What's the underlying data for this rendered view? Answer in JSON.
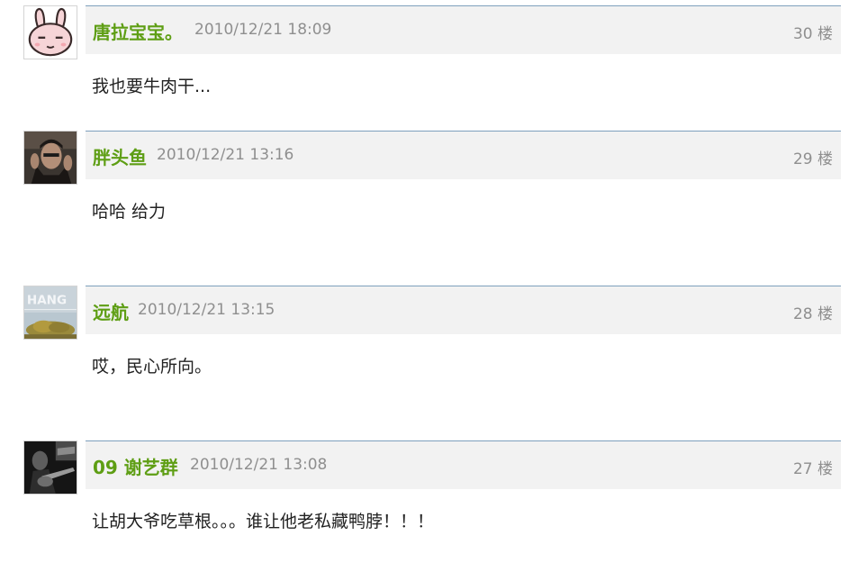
{
  "posts": [
    {
      "author": "唐拉宝宝。",
      "time": "2010/12/21 18:09",
      "floor": "30 楼",
      "content": "我也要牛肉干...",
      "avatar_icon": "bunny-avatar-icon"
    },
    {
      "author": "胖头鱼",
      "time": "2010/12/21 13:16",
      "floor": "29 楼",
      "content": "哈哈 给力",
      "avatar_icon": "man-portrait-avatar-icon"
    },
    {
      "author": "远航",
      "time": "2010/12/21 13:15",
      "floor": "28 楼",
      "content": "哎，民心所向。",
      "avatar_icon": "hang-tree-avatar-icon",
      "avatar_text": "HANG"
    },
    {
      "author": "09 谢艺群",
      "time": "2010/12/21 13:08",
      "floor": "27 楼",
      "content": "让胡大爷吃草根。。。谁让他老私藏鸭脖！！！",
      "avatar_icon": "guitarist-avatar-icon"
    }
  ],
  "colors": {
    "author": "#5e9e14",
    "meta": "#8f8f8f",
    "header_bg": "#f2f2f2",
    "header_border": "#7ea0bd",
    "content": "#222222"
  }
}
